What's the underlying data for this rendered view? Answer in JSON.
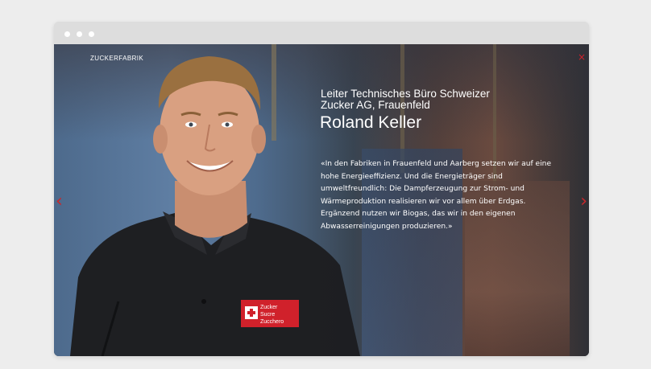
{
  "window": {
    "controls": [
      "window-dot",
      "window-dot",
      "window-dot"
    ]
  },
  "slide": {
    "brand_label": "ZUCKERFABRIK",
    "close_glyph": "×",
    "prev_glyph": "‹",
    "next_glyph": "›",
    "role_line1": "Leiter Technisches Büro Schweizer",
    "role_line2": "Zucker AG, Frauenfeld",
    "name": "Roland Keller",
    "quote": "«In den Fabriken in Frauenfeld und Aarberg setzen wir auf eine hohe Energieeffizienz. Und die Energieträger sind umweltfreundlich: Die Dampferzeugung zur Strom- und Wärmeproduktion realisieren wir vor allem über Erdgas. Ergänzend nutzen wir Biogas, das wir in den eigenen Abwasserreinigungen produzieren.»",
    "shirt_logo_lines": [
      "Zucker",
      "Sucre",
      "Zucchero"
    ]
  },
  "pager": {
    "total": 6,
    "active_index": 3
  },
  "colors": {
    "accent": "#d0212b",
    "page_bg": "#ededed",
    "titlebar": "#dddddd"
  }
}
